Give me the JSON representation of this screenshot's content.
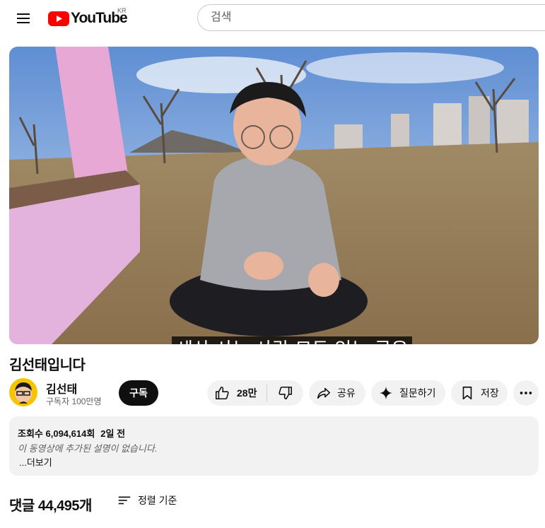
{
  "header": {
    "menu_icon": "hamburger-menu-icon",
    "logo_text": "YouTube",
    "logo_region": "KR",
    "brand_color": "#ff0000",
    "search_placeholder": "검색"
  },
  "video": {
    "caption": "세상 사는 사람 모두 있는 곳은",
    "title": "김선태입니다"
  },
  "channel": {
    "name": "김선태",
    "subscribers": "구독자 100만명",
    "subscribe_label": "구독"
  },
  "actions": {
    "like_count": "28만",
    "share_label": "공유",
    "ask_label": "질문하기",
    "save_label": "저장",
    "icons": [
      "thumb-up-icon",
      "thumb-down-icon",
      "share-arrow-icon",
      "sparkle-icon",
      "bookmark-icon",
      "more-dots-icon"
    ]
  },
  "description": {
    "views": "조회수 6,094,614회",
    "age": "2일 전",
    "text": "이 동영상에 추가된 설명이 없습니다.",
    "more_label": "...더보기"
  },
  "comments": {
    "count_label": "댓글 44,495개",
    "sort_label": "정렬 기준"
  }
}
